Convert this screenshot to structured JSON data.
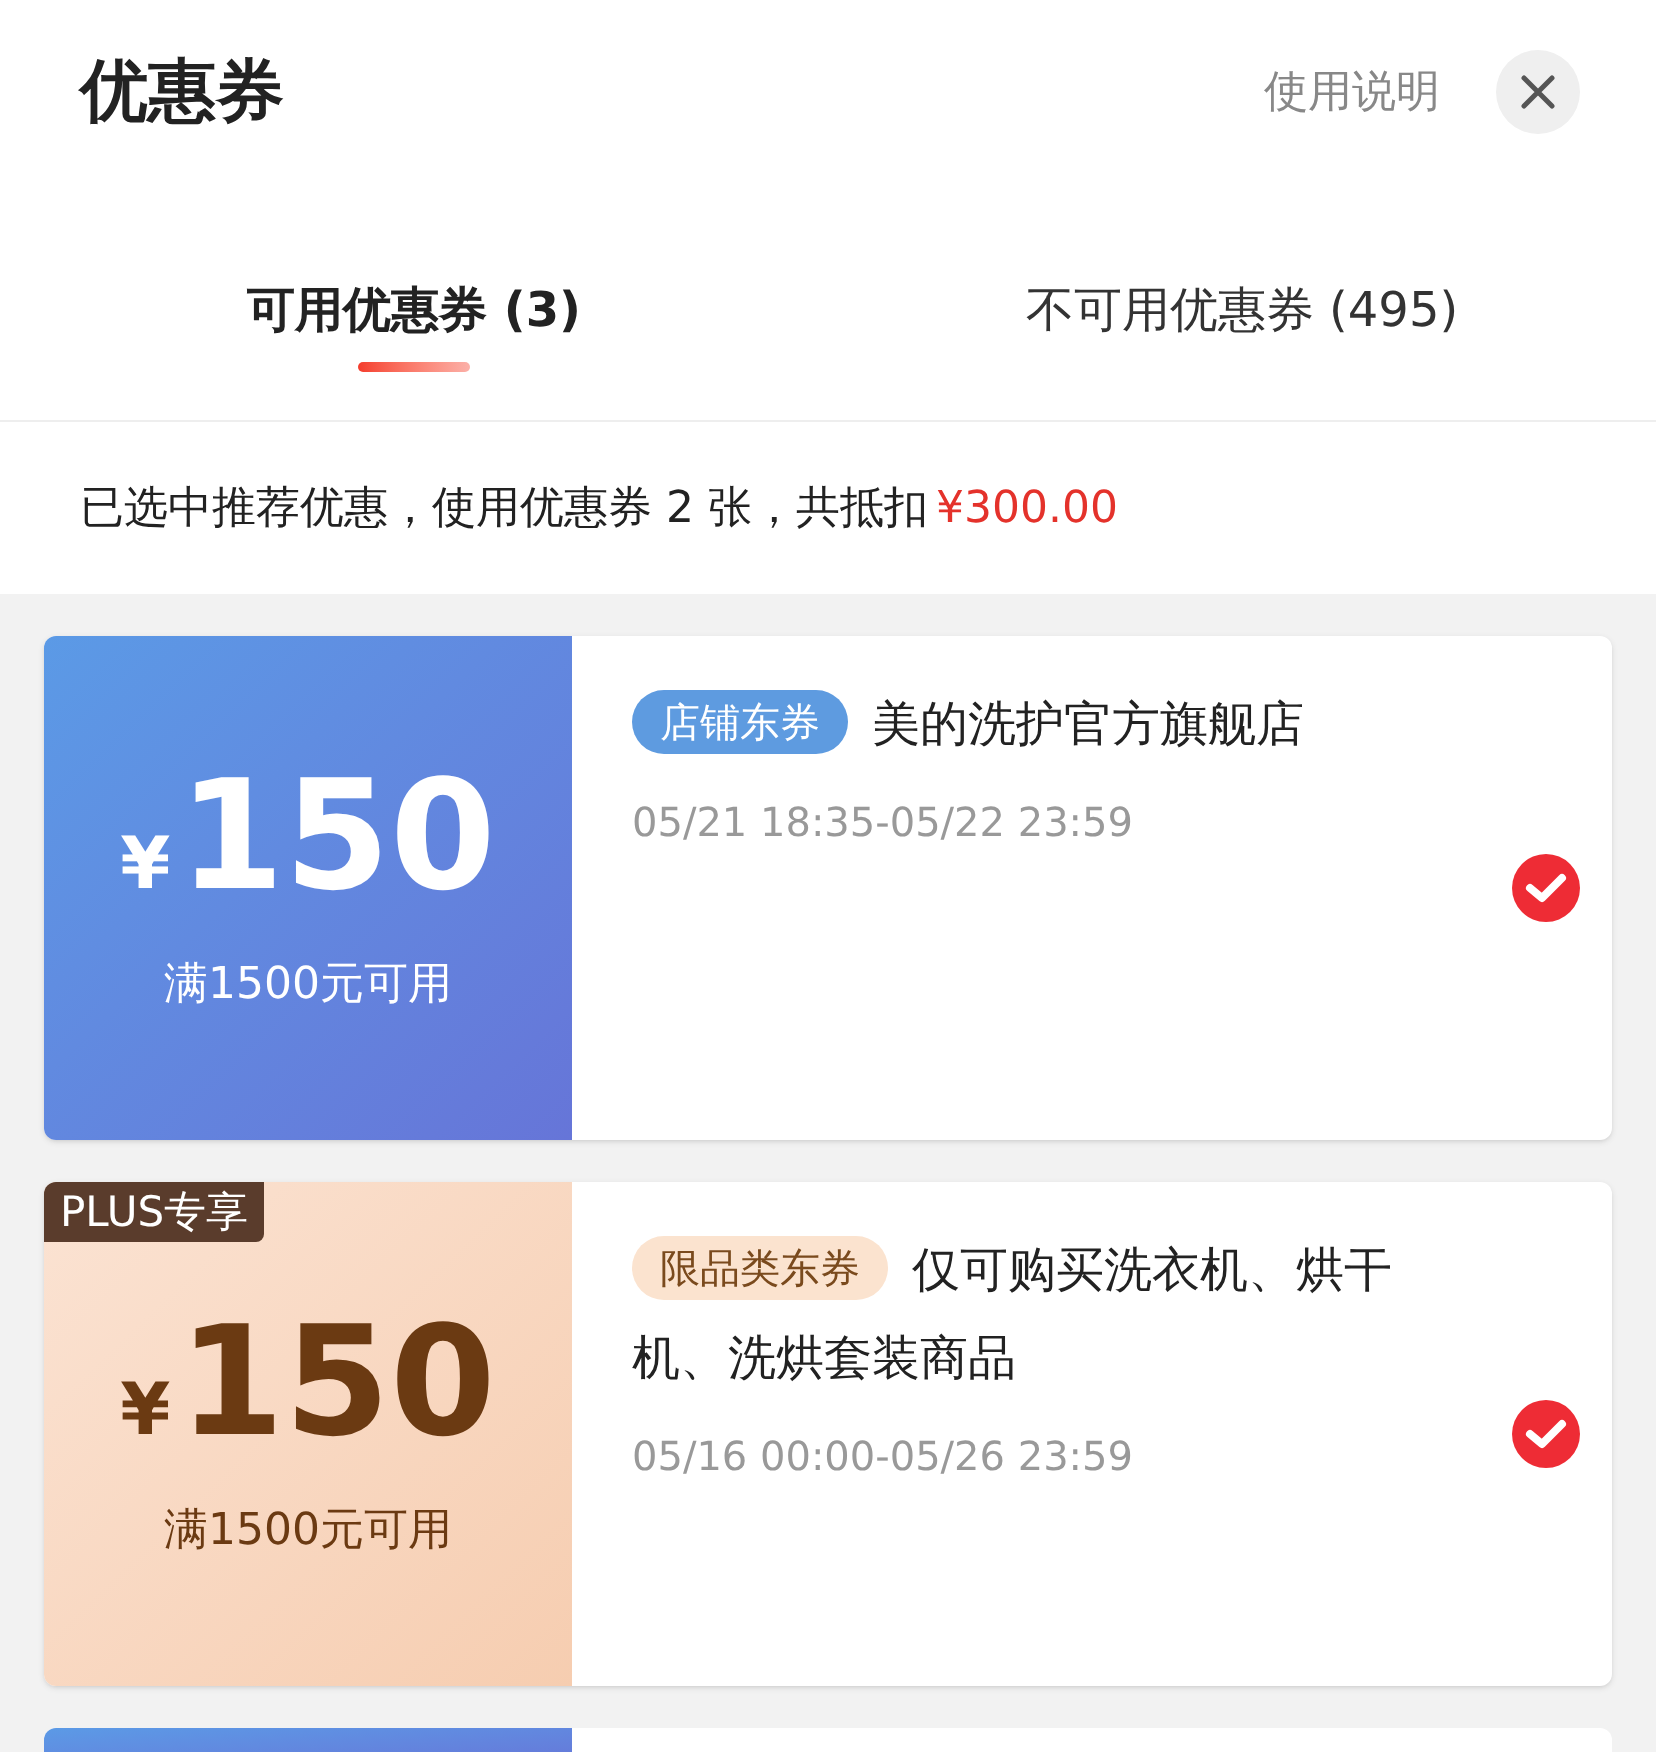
{
  "title": "优惠券",
  "help_link": "使用说明",
  "tabs": [
    {
      "label": "可用优惠券 (3)",
      "selected": true
    },
    {
      "label": "不可用优惠券 (495)",
      "selected": false
    }
  ],
  "summary": {
    "text": "已选中推荐优惠，使用优惠券 2 张，共抵扣",
    "amount": "¥300.00"
  },
  "coupons": [
    {
      "kind": "store",
      "currency": "¥",
      "amount": "150",
      "condition": "满1500元可用",
      "tag": "店铺东券",
      "title": "美的洗护官方旗舰店",
      "period": "05/21 18:35-05/22 23:59",
      "selected": true
    },
    {
      "kind": "plus",
      "badge": "PLUS专享",
      "currency": "¥",
      "amount": "150",
      "condition": "满1500元可用",
      "tag": "限品类东券",
      "title": "仅可购买洗衣机、烘干机、洗烘套装商品",
      "period": "05/16 00:00-05/26 23:59",
      "selected": true
    },
    {
      "kind": "store",
      "partial": true
    }
  ]
}
